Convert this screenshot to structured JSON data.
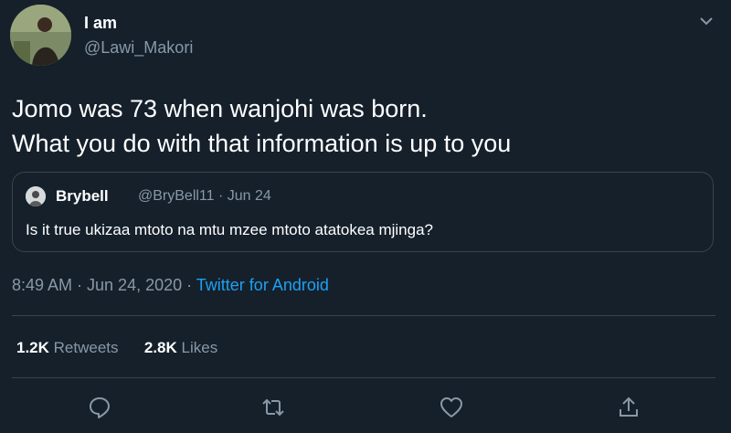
{
  "author": {
    "display_name": "I am",
    "handle": "@Lawi_Makori"
  },
  "tweet": {
    "line1": "Jomo was 73 when wanjohi was born.",
    "line2": "What you do with that information is up to you"
  },
  "quoted": {
    "name": "Brybell",
    "handle_date": "@BryBell11 · Jun 24",
    "text": "Is it true ukizaa mtoto na mtu mzee mtoto atatokea mjinga?"
  },
  "meta": {
    "timestamp": "8:49 AM · Jun 24, 2020 · ",
    "source": "Twitter for Android"
  },
  "stats": {
    "retweets_count": "1.2K",
    "retweets_label": "Retweets",
    "likes_count": "2.8K",
    "likes_label": "Likes"
  },
  "colors": {
    "background": "#15202b",
    "muted": "#8899a6",
    "link": "#1da1f2",
    "border": "#38444d"
  }
}
